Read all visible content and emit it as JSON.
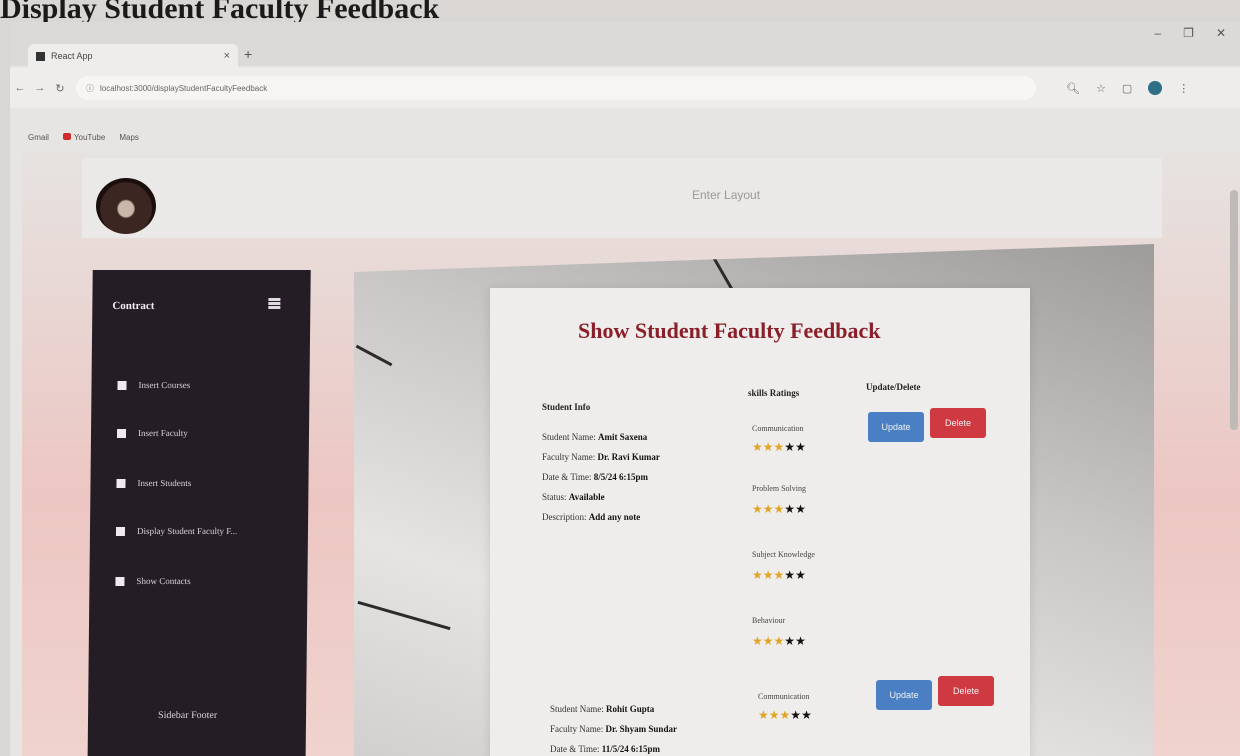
{
  "document": {
    "caption": "Display Student Faculty Feedback"
  },
  "browser": {
    "tab_title": "React App",
    "tab_close": "×",
    "new_tab": "+",
    "window_controls": [
      "–",
      "❐",
      "✕"
    ],
    "address": "localhost:3000/displayStudentFacultyFeedback",
    "bookmarks": [
      "Gmail",
      "YouTube",
      "Maps"
    ]
  },
  "navbar": {
    "link": "Enter Layout"
  },
  "sidebar": {
    "title": "Contract",
    "items": [
      {
        "label": "Insert Courses"
      },
      {
        "label": "Insert Faculty"
      },
      {
        "label": "Insert Students"
      },
      {
        "label": "Display Student Faculty F..."
      },
      {
        "label": "Show Contacts"
      }
    ],
    "footer": "Sidebar Footer"
  },
  "card": {
    "title": "Show Student Faculty Feedback",
    "headers": {
      "details": "Student Info",
      "ratings": "skills Ratings",
      "actions": "Update/Delete"
    },
    "update_label": "Update",
    "delete_label": "Delete",
    "records": [
      {
        "student_label": "Student Name:",
        "student_name": "Amit Saxena",
        "faculty_label": "Faculty Name:",
        "faculty_name": "Dr. Ravi Kumar",
        "date_label": "Date & Time:",
        "date": "8/5/24 6:15pm",
        "status_label": "Status:",
        "status": "Available",
        "description_label": "Description:",
        "description": "Add any note",
        "skills": [
          {
            "label": "Communication",
            "rating": 3,
            "max": 5
          },
          {
            "label": "Problem Solving",
            "rating": 3,
            "max": 5
          },
          {
            "label": "Subject Knowledge",
            "rating": 3,
            "max": 5
          },
          {
            "label": "Behaviour",
            "rating": 3,
            "max": 5
          }
        ]
      },
      {
        "student_label": "Student Name:",
        "student_name": "Rohit Gupta",
        "faculty_label": "Faculty Name:",
        "faculty_name": "Dr. Shyam Sundar",
        "date_label": "Date & Time:",
        "date": "11/5/24 6:15pm",
        "skills": [
          {
            "label": "Communication",
            "rating": 3,
            "max": 5
          }
        ]
      }
    ]
  },
  "colors": {
    "card_title": "#8a1f2a",
    "update_button": "#4a7fc4",
    "delete_button": "#cf3a42",
    "star_on": "#e0a526",
    "star_off": "#111111",
    "sidebar_bg": "#241d26"
  }
}
